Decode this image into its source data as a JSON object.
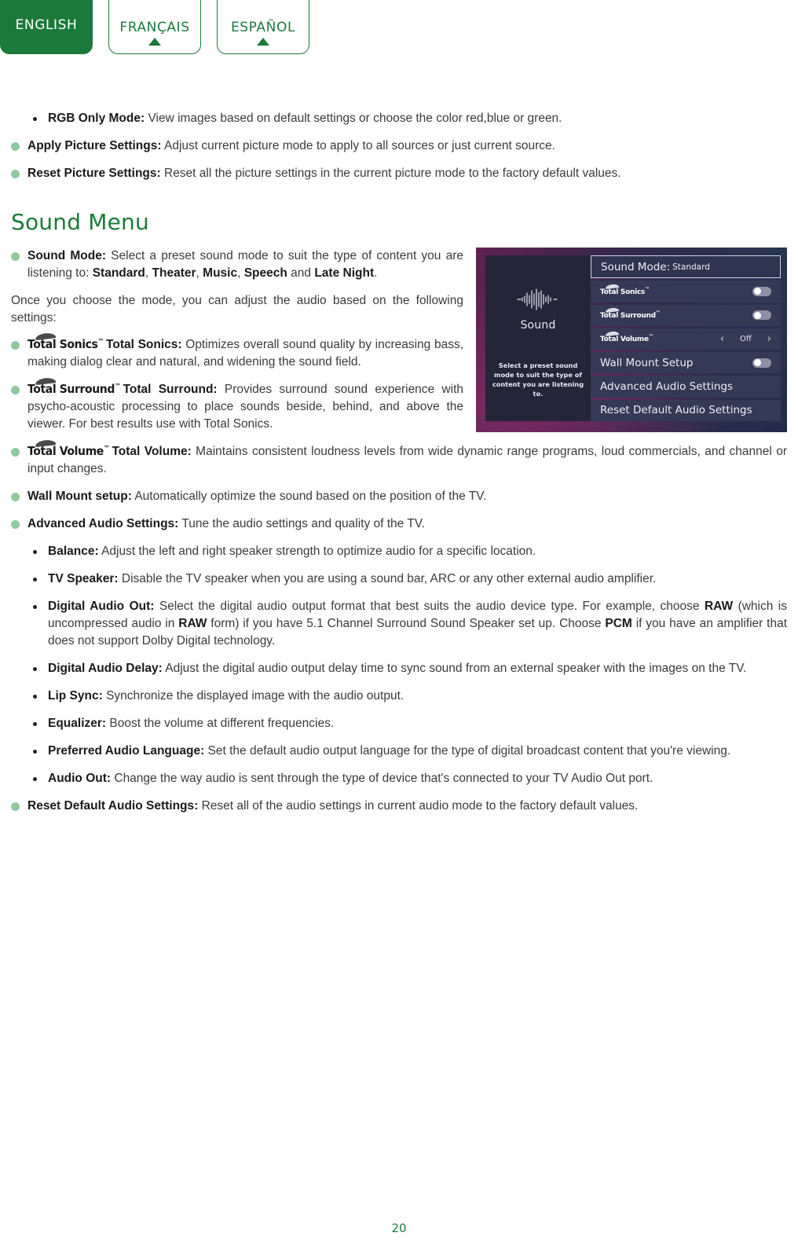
{
  "language_tabs": [
    {
      "label": "ENGLISH",
      "active": true
    },
    {
      "label": "FRANÇAIS",
      "active": false
    },
    {
      "label": "ESPAÑOL",
      "active": false
    }
  ],
  "top_items": [
    {
      "bullet": "small",
      "term": "RGB Only Mode:",
      "desc": " View images based on default settings or choose the color red,blue or green."
    },
    {
      "bullet": "large",
      "term": "Apply Picture Settings:",
      "desc": " Adjust current picture mode to apply to all sources or just current source."
    },
    {
      "bullet": "large",
      "term": "Reset Picture Settings:",
      "desc": " Reset all the picture settings in the current picture mode to the factory default values."
    }
  ],
  "section": {
    "heading": "Sound Menu"
  },
  "sound_mode": {
    "term": "Sound Mode:",
    "desc_1": " Select a preset sound mode to suit the type of content you are listening to: ",
    "mode_1": "Standard",
    "sep_1": ", ",
    "mode_2": "Theater",
    "sep_2": ", ",
    "mode_3": "Music",
    "sep_3": ", ",
    "mode_4": "Speech",
    "sep_4": " and ",
    "mode_5": "Late Night",
    "sep_5": "."
  },
  "intro_paragraph": "Once you choose the mode, you can adjust the audio based on the following settings:",
  "brand_items": [
    {
      "brand_text": "Total Sonics",
      "brand_tm": "™",
      "term": "Total Sonics:",
      "desc": " Optimizes overall sound quality by increasing bass, making dialog clear and natural, and widening the sound field."
    },
    {
      "brand_text": "Total Surround",
      "brand_tm": "™",
      "term": "Total Surround:",
      "desc": " Provides surround sound experience with psycho-acoustic processing to place sounds beside, behind, and above the viewer. For best results use with Total Sonics."
    },
    {
      "brand_text": "Total Volume",
      "brand_tm": "™",
      "term": "Total Volume:",
      "desc": " Maintains consistent loudness levels from wide dynamic range programs, loud commercials, and channel or input changes."
    }
  ],
  "main_items": [
    {
      "term": "Wall Mount setup:",
      "desc": " Automatically optimize the sound based on the position of the TV."
    },
    {
      "term": "Advanced Audio Settings:",
      "desc": " Tune the audio settings and quality of the TV."
    }
  ],
  "sub_items": [
    {
      "term": "Balance:",
      "desc": " Adjust the left and right speaker strength to optimize audio for a specific location."
    },
    {
      "term": "TV Speaker:",
      "desc": " Disable the TV speaker when you are using a sound bar, ARC or any other external audio amplifier."
    },
    {
      "term": "Digital Audio Out:",
      "desc": " Select the digital audio output format that best suits the audio device type. For example, choose RAW (which is uncompressed audio in RAW form) if you have 5.1 Channel Surround Sound Speaker set up. Choose PCM if you have an amplifier that does not support Dolby Digital technology.",
      "bold_words": [
        "RAW",
        "PCM"
      ]
    },
    {
      "term": "Digital Audio Delay:",
      "desc": " Adjust the digital audio output delay time to sync sound from an external speaker with the images on the TV."
    },
    {
      "term": "Lip Sync:",
      "desc": " Synchronize the displayed image with the audio output."
    },
    {
      "term": "Equalizer:",
      "desc": " Boost the volume at different frequencies."
    },
    {
      "term": "Preferred Audio Language:",
      "desc": " Set the default audio output language for the type of digital broadcast content that you're viewing."
    },
    {
      "term": "Audio Out:",
      "desc": " Change the way audio is sent through the type of device that's connected to your TV Audio Out port."
    }
  ],
  "final_item": {
    "term": "Reset Default Audio Settings:",
    "desc": " Reset all of the audio settings in current audio mode to the factory default values."
  },
  "tv_figure": {
    "left_panel": {
      "title": "Sound",
      "description": "Select a preset sound mode to suit the type of content you are listening to."
    },
    "rows": [
      {
        "type": "highlight",
        "label": "Sound Mode:",
        "value": "Standard"
      },
      {
        "type": "toggle",
        "brand": "Total Sonics",
        "tm": "™",
        "state": "off"
      },
      {
        "type": "toggle",
        "brand": "Total Surround",
        "tm": "™",
        "state": "off"
      },
      {
        "type": "stepper",
        "brand": "Total Volume",
        "tm": "™",
        "value": "Off",
        "prev": "‹",
        "next": "›"
      },
      {
        "type": "toggle",
        "label": "Wall Mount Setup",
        "state": "off"
      },
      {
        "type": "plain",
        "label": "Advanced Audio Settings"
      },
      {
        "type": "plain",
        "label": "Reset Default Audio Settings"
      }
    ]
  },
  "page_number": "20",
  "colors": {
    "brand_green": "#1b7a3b",
    "bullet_green": "#8fc99f",
    "body_text": "#3b3b3b",
    "tv_menu_bg": "#343a55",
    "tv_panel_bg": "#242638"
  }
}
